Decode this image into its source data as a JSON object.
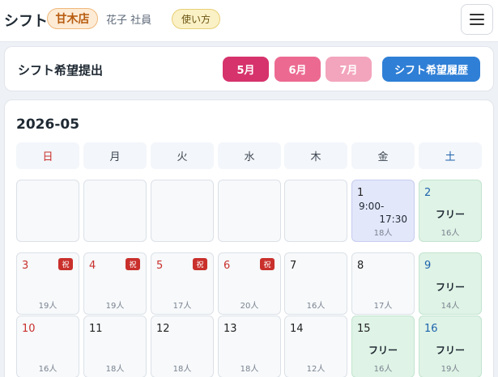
{
  "header": {
    "title": "シフト",
    "store": "甘木店",
    "user": "花子 社員",
    "help": "使い方",
    "menu_icon": "hamburger-icon"
  },
  "submit": {
    "title": "シフト希望提出",
    "months": [
      "5月",
      "6月",
      "7月"
    ],
    "month_colors": [
      "#d6336c",
      "#ec6a92",
      "#f3a5bd"
    ],
    "history": "シフト希望履歴"
  },
  "calendar": {
    "month": "2026-05",
    "weekdays": [
      "日",
      "月",
      "火",
      "水",
      "木",
      "金",
      "土"
    ],
    "free_label": "フリー",
    "holiday_label": "祝",
    "weeks": [
      [
        {
          "type": "empty"
        },
        {
          "type": "empty"
        },
        {
          "type": "empty"
        },
        {
          "type": "empty"
        },
        {
          "type": "empty"
        },
        {
          "day": "1",
          "count": "18人",
          "type": "shift",
          "start": "9:00-",
          "end": "17:30"
        },
        {
          "day": "2",
          "count": "16人",
          "type": "free"
        }
      ],
      [
        {
          "day": "3",
          "count": "19人",
          "holiday": true
        },
        {
          "day": "4",
          "count": "19人",
          "holiday": true
        },
        {
          "day": "5",
          "count": "17人",
          "holiday": true
        },
        {
          "day": "6",
          "count": "20人",
          "holiday": true
        },
        {
          "day": "7",
          "count": "16人"
        },
        {
          "day": "8",
          "count": "17人"
        },
        {
          "day": "9",
          "count": "14人",
          "type": "free"
        }
      ],
      [
        {
          "day": "10",
          "count": "16人"
        },
        {
          "day": "11",
          "count": "18人"
        },
        {
          "day": "12",
          "count": "18人"
        },
        {
          "day": "13",
          "count": "18人"
        },
        {
          "day": "14",
          "count": "12人"
        },
        {
          "day": "15",
          "count": "16人",
          "type": "free"
        },
        {
          "day": "16",
          "count": "19人",
          "type": "free"
        }
      ]
    ]
  }
}
